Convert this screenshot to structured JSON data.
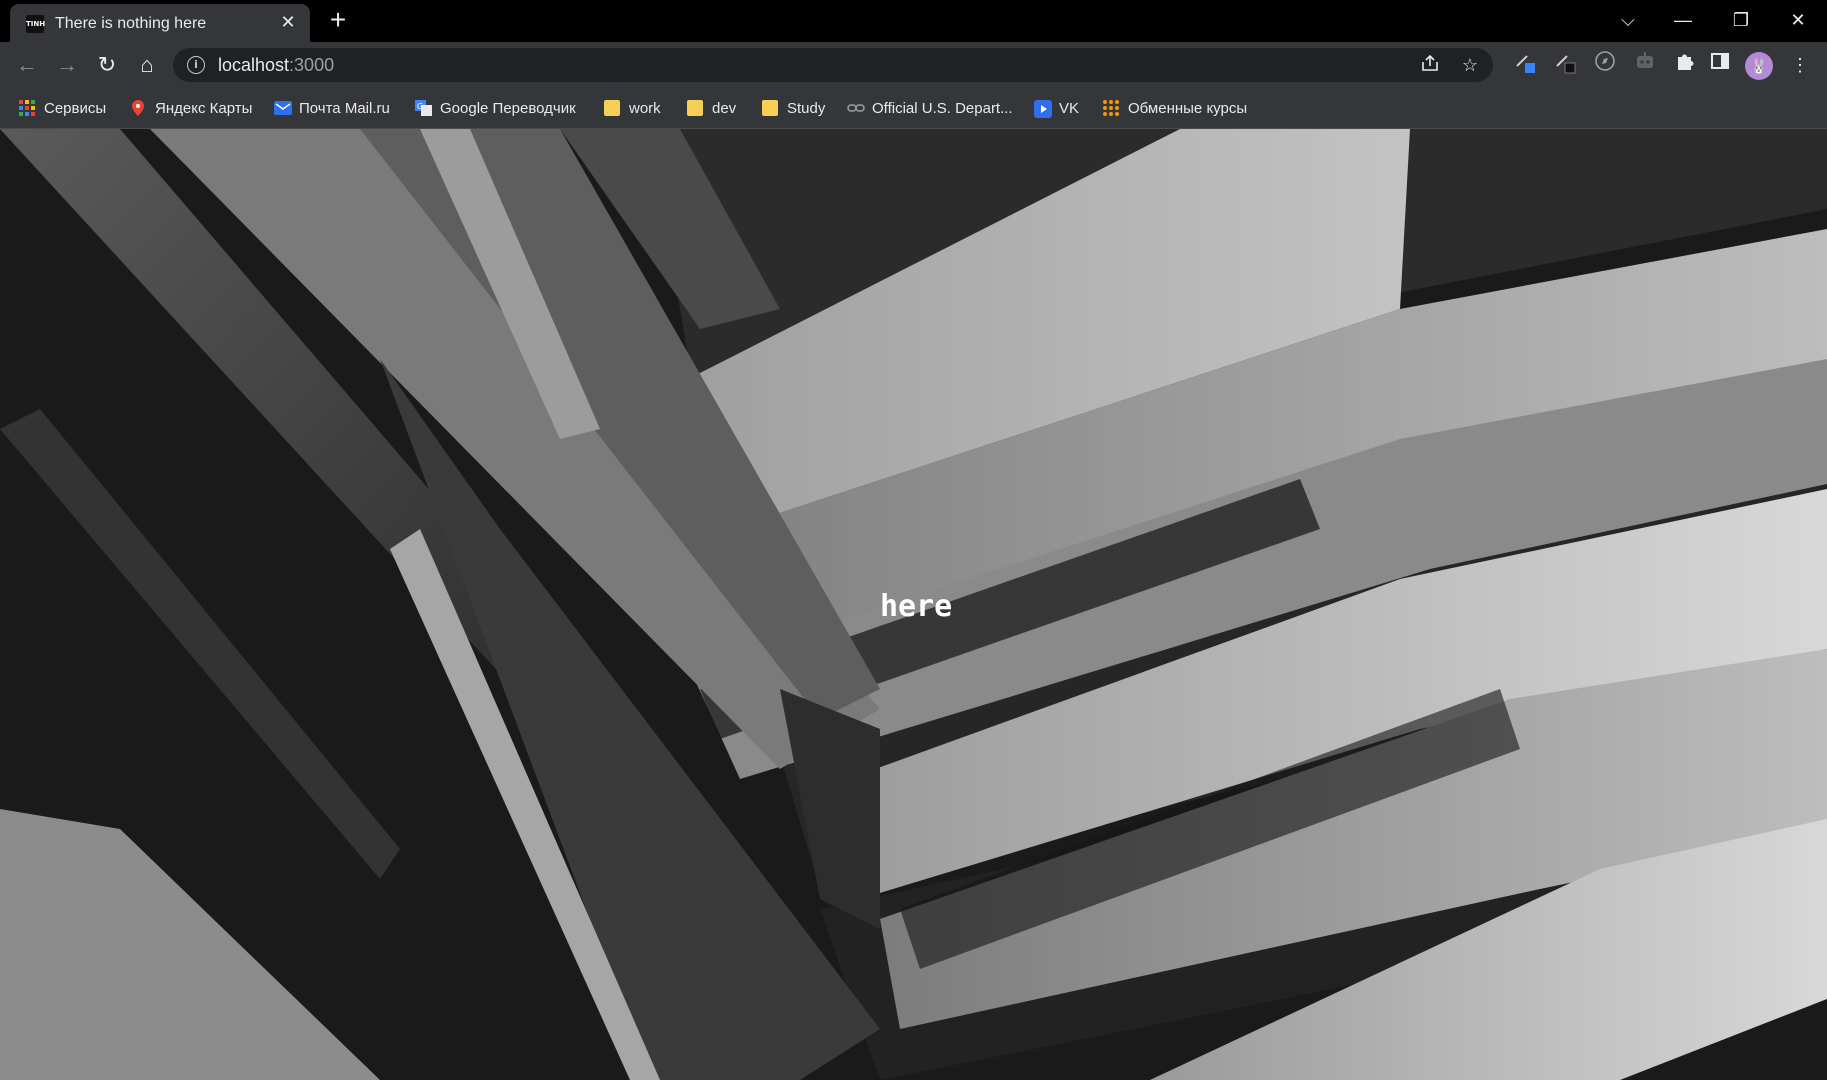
{
  "tab": {
    "favicon_text": "TINH",
    "title": "There is nothing here",
    "close": "✕",
    "new_tab": "+"
  },
  "window": {
    "dropdown": "⌵",
    "minimize": "—",
    "restore": "❐",
    "close": "✕"
  },
  "nav": {
    "back": "←",
    "forward": "→",
    "reload": "↻",
    "home": "⌂"
  },
  "address": {
    "host": "localhost",
    "port": ":3000",
    "share_icon": "share-icon",
    "star_icon": "star-icon"
  },
  "extensions": [
    "pen-blue-icon",
    "pen-black-icon",
    "compass-icon",
    "robot-icon",
    "puzzle-icon",
    "sidepanel-icon"
  ],
  "avatar_label": "🐰",
  "menu": "⋮",
  "bookmarks": [
    {
      "label": "Сервисы",
      "icon": "apps-grid-icon"
    },
    {
      "label": "Яндекс Карты",
      "icon": "map-pin-icon"
    },
    {
      "label": "Почта Mail.ru",
      "icon": "mail-icon"
    },
    {
      "label": "Google Переводчик",
      "icon": "translate-icon"
    },
    {
      "label": "work",
      "icon": "folder-icon"
    },
    {
      "label": "dev",
      "icon": "folder-icon"
    },
    {
      "label": "Study",
      "icon": "folder-icon"
    },
    {
      "label": "Official U.S. Depart...",
      "icon": "link-icon"
    },
    {
      "label": "VK",
      "icon": "vk-icon"
    },
    {
      "label": "Обменные курсы",
      "icon": "apps-grid-orange-icon"
    }
  ],
  "page": {
    "message": "here"
  },
  "colors": {
    "tab_bar": "#000000",
    "toolbar": "#35363a",
    "omnibox": "#202124",
    "text": "#e8eaed",
    "folder": "#f6cf57"
  }
}
